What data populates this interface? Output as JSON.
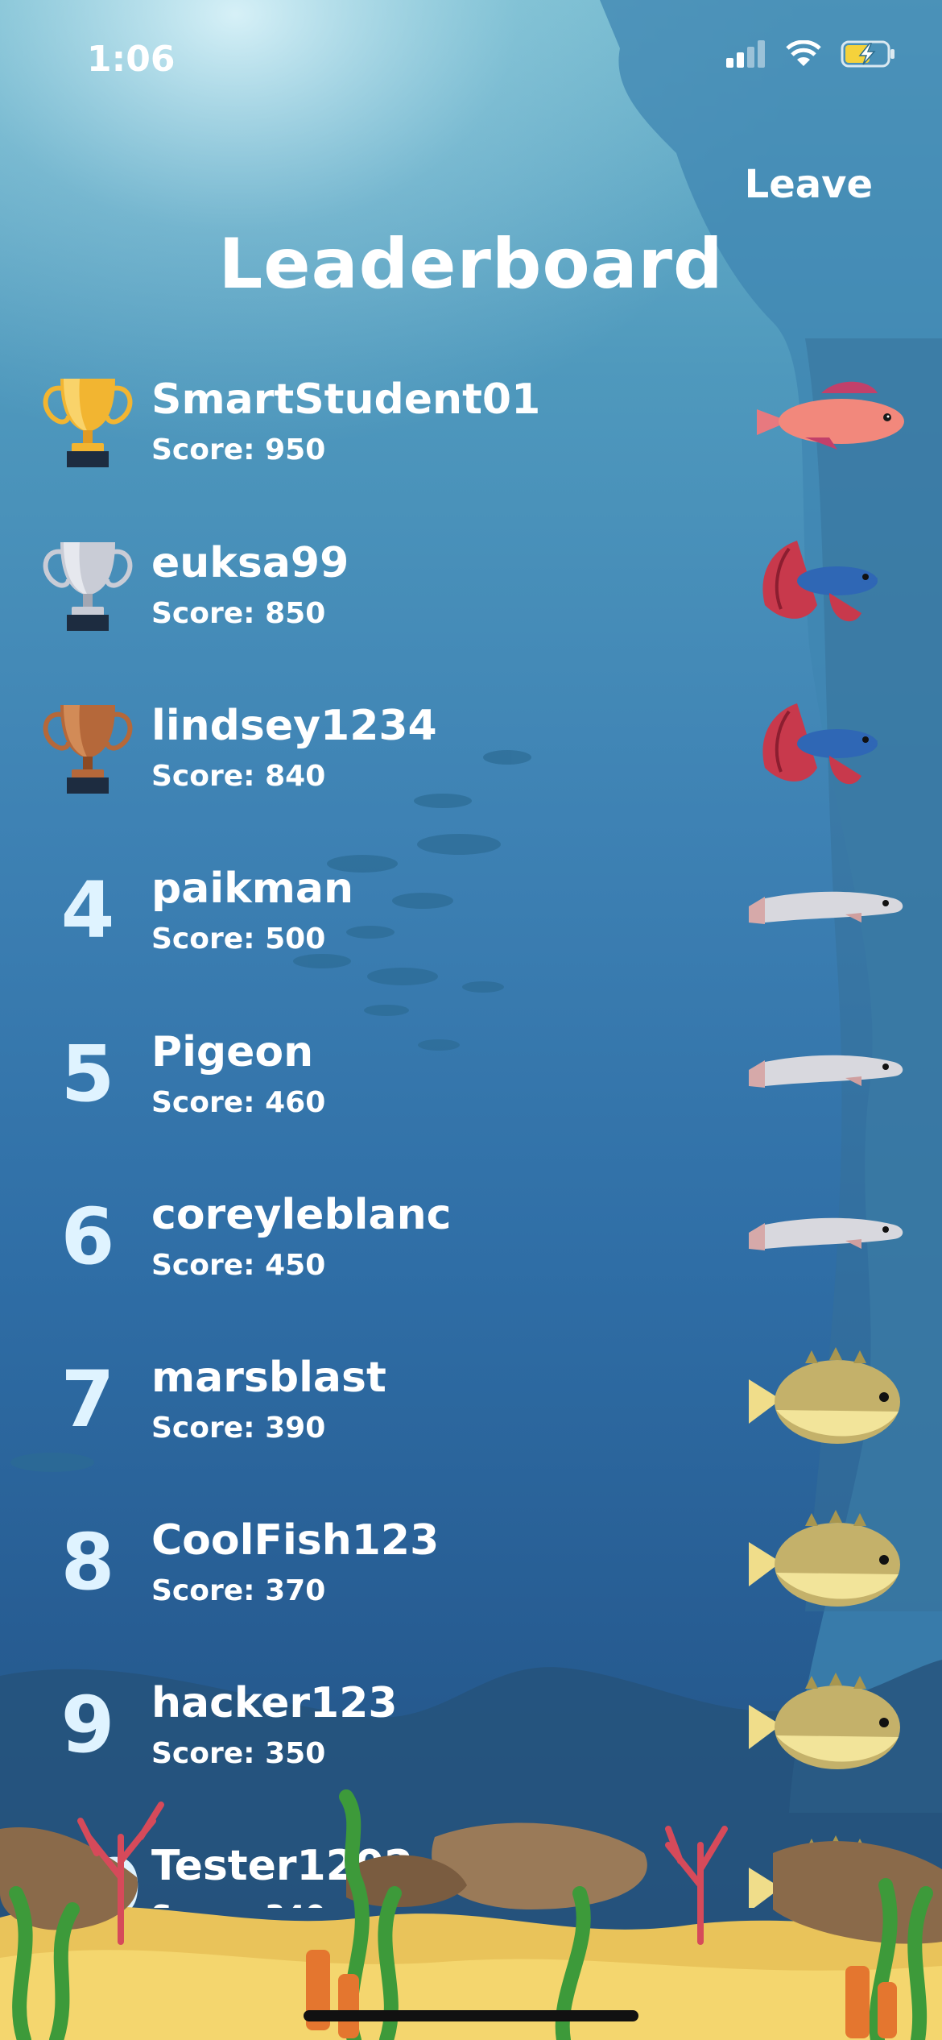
{
  "status_bar": {
    "time": "1:06"
  },
  "header": {
    "leave_label": "Leave",
    "title": "Leaderboard"
  },
  "players": [
    {
      "rank": "1",
      "name": "SmartStudent01",
      "score": "Score: 950",
      "badge": "gold-trophy",
      "fish": "pink-fish"
    },
    {
      "rank": "2",
      "name": "euksa99",
      "score": "Score: 850",
      "badge": "silver-trophy",
      "fish": "betta-fish"
    },
    {
      "rank": "3",
      "name": "lindsey1234",
      "score": "Score: 840",
      "badge": "bronze-trophy",
      "fish": "betta-fish"
    },
    {
      "rank": "4",
      "name": "paikman",
      "score": "Score: 500",
      "badge": "number",
      "fish": "eel-fish"
    },
    {
      "rank": "5",
      "name": "Pigeon",
      "score": "Score: 460",
      "badge": "number",
      "fish": "eel-fish"
    },
    {
      "rank": "6",
      "name": "coreyleblanc",
      "score": "Score: 450",
      "badge": "number",
      "fish": "eel-fish"
    },
    {
      "rank": "7",
      "name": "marsblast",
      "score": "Score: 390",
      "badge": "number",
      "fish": "puffer-fish"
    },
    {
      "rank": "8",
      "name": "CoolFish123",
      "score": "Score: 370",
      "badge": "number",
      "fish": "puffer-fish"
    },
    {
      "rank": "9",
      "name": "hacker123",
      "score": "Score: 350",
      "badge": "number",
      "fish": "puffer-fish"
    },
    {
      "rank": "10",
      "name": "Tester1202",
      "score": "Score: 340",
      "badge": "number",
      "fish": "puffer-fish"
    }
  ],
  "colors": {
    "gold": "#f2b531",
    "silver": "#c9ccd6",
    "bronze": "#b5683a",
    "rank_number": "#dff3ff"
  }
}
